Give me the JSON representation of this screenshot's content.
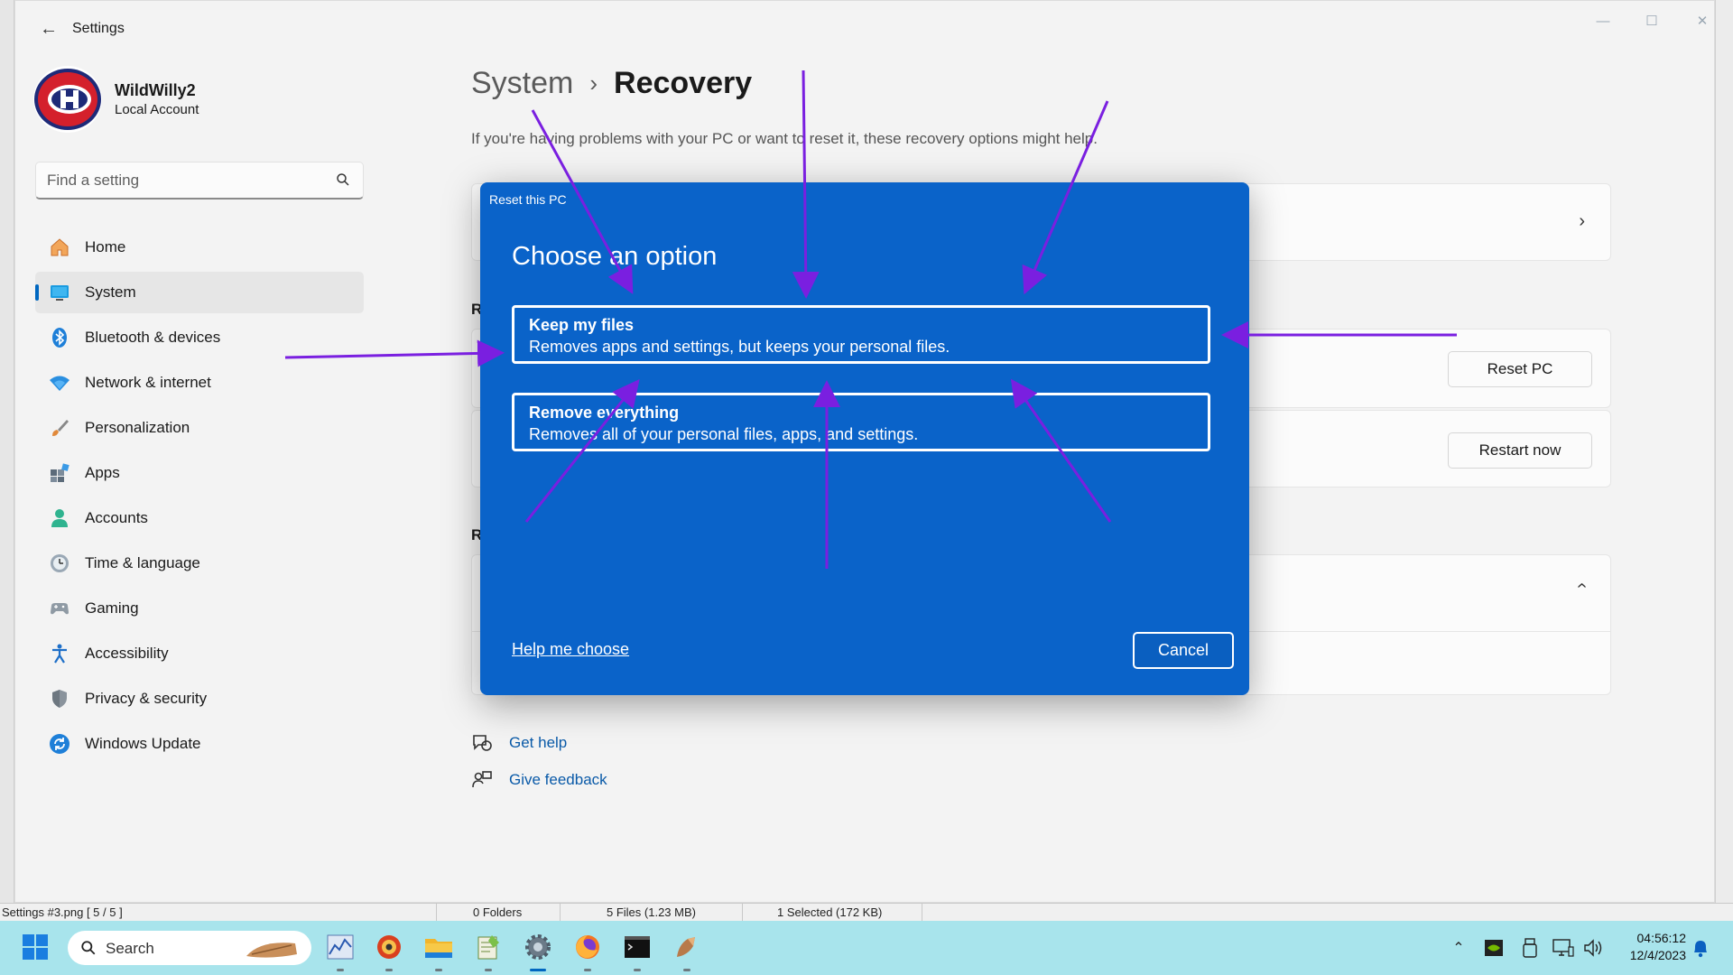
{
  "window": {
    "app_title": "Settings",
    "back_glyph": "←",
    "controls": {
      "minimize": "—",
      "maximize": "☐",
      "close": "✕"
    }
  },
  "profile": {
    "name": "WildWilly2",
    "account_type": "Local Account",
    "avatar_icon": "habs-logo-avatar"
  },
  "search": {
    "placeholder": "Find a setting",
    "icon": "search-icon"
  },
  "sidebar": {
    "items": [
      {
        "label": "Home",
        "icon": "home-icon"
      },
      {
        "label": "System",
        "icon": "system-icon",
        "active": true
      },
      {
        "label": "Bluetooth & devices",
        "icon": "bluetooth-icon"
      },
      {
        "label": "Network & internet",
        "icon": "wifi-icon"
      },
      {
        "label": "Personalization",
        "icon": "brush-icon"
      },
      {
        "label": "Apps",
        "icon": "apps-icon"
      },
      {
        "label": "Accounts",
        "icon": "person-icon"
      },
      {
        "label": "Time & language",
        "icon": "clock-globe-icon"
      },
      {
        "label": "Gaming",
        "icon": "gamepad-icon"
      },
      {
        "label": "Accessibility",
        "icon": "accessibility-icon"
      },
      {
        "label": "Privacy & security",
        "icon": "shield-icon"
      },
      {
        "label": "Windows Update",
        "icon": "refresh-icon"
      }
    ]
  },
  "main": {
    "breadcrumb": {
      "parent": "System",
      "separator": "›",
      "current": "Recovery"
    },
    "subtitle": "If you're having problems with your PC or want to reset it, these recovery options might help.",
    "section_letters": [
      "R",
      "R"
    ],
    "buttons": {
      "reset_pc": "Reset PC",
      "restart_now": "Restart now"
    },
    "links": {
      "get_help": "Get help",
      "give_feedback": "Give feedback"
    }
  },
  "dialog": {
    "window_title": "Reset this PC",
    "heading": "Choose an option",
    "options": [
      {
        "title": "Keep my files",
        "description": "Removes apps and settings, but keeps your personal files."
      },
      {
        "title": "Remove everything",
        "description": "Removes all of your personal files, apps, and settings."
      }
    ],
    "help_link": "Help me choose",
    "cancel": "Cancel"
  },
  "statusbar": {
    "filename": "Settings #3.png [ 5 / 5 ]",
    "folders": "0 Folders",
    "files": "5 Files (1.23 MB)",
    "selected": "1 Selected (172 KB)"
  },
  "taskbar": {
    "search_label": "Search",
    "apps": [
      {
        "name": "stock-chart-app-icon"
      },
      {
        "name": "irfanview-icon"
      },
      {
        "name": "file-explorer-icon"
      },
      {
        "name": "notepad-plus-icon"
      },
      {
        "name": "settings-gear-icon",
        "active": true
      },
      {
        "name": "firefox-icon"
      },
      {
        "name": "terminal-icon"
      },
      {
        "name": "paint-app-icon"
      }
    ],
    "clock": {
      "time": "04:56:12",
      "date": "12/4/2023"
    }
  },
  "colors": {
    "accent": "#0067c0",
    "dialog_bg": "#0a63c9",
    "arrow": "#7a1fe0",
    "taskbar_bg": "#a8e4ec"
  }
}
